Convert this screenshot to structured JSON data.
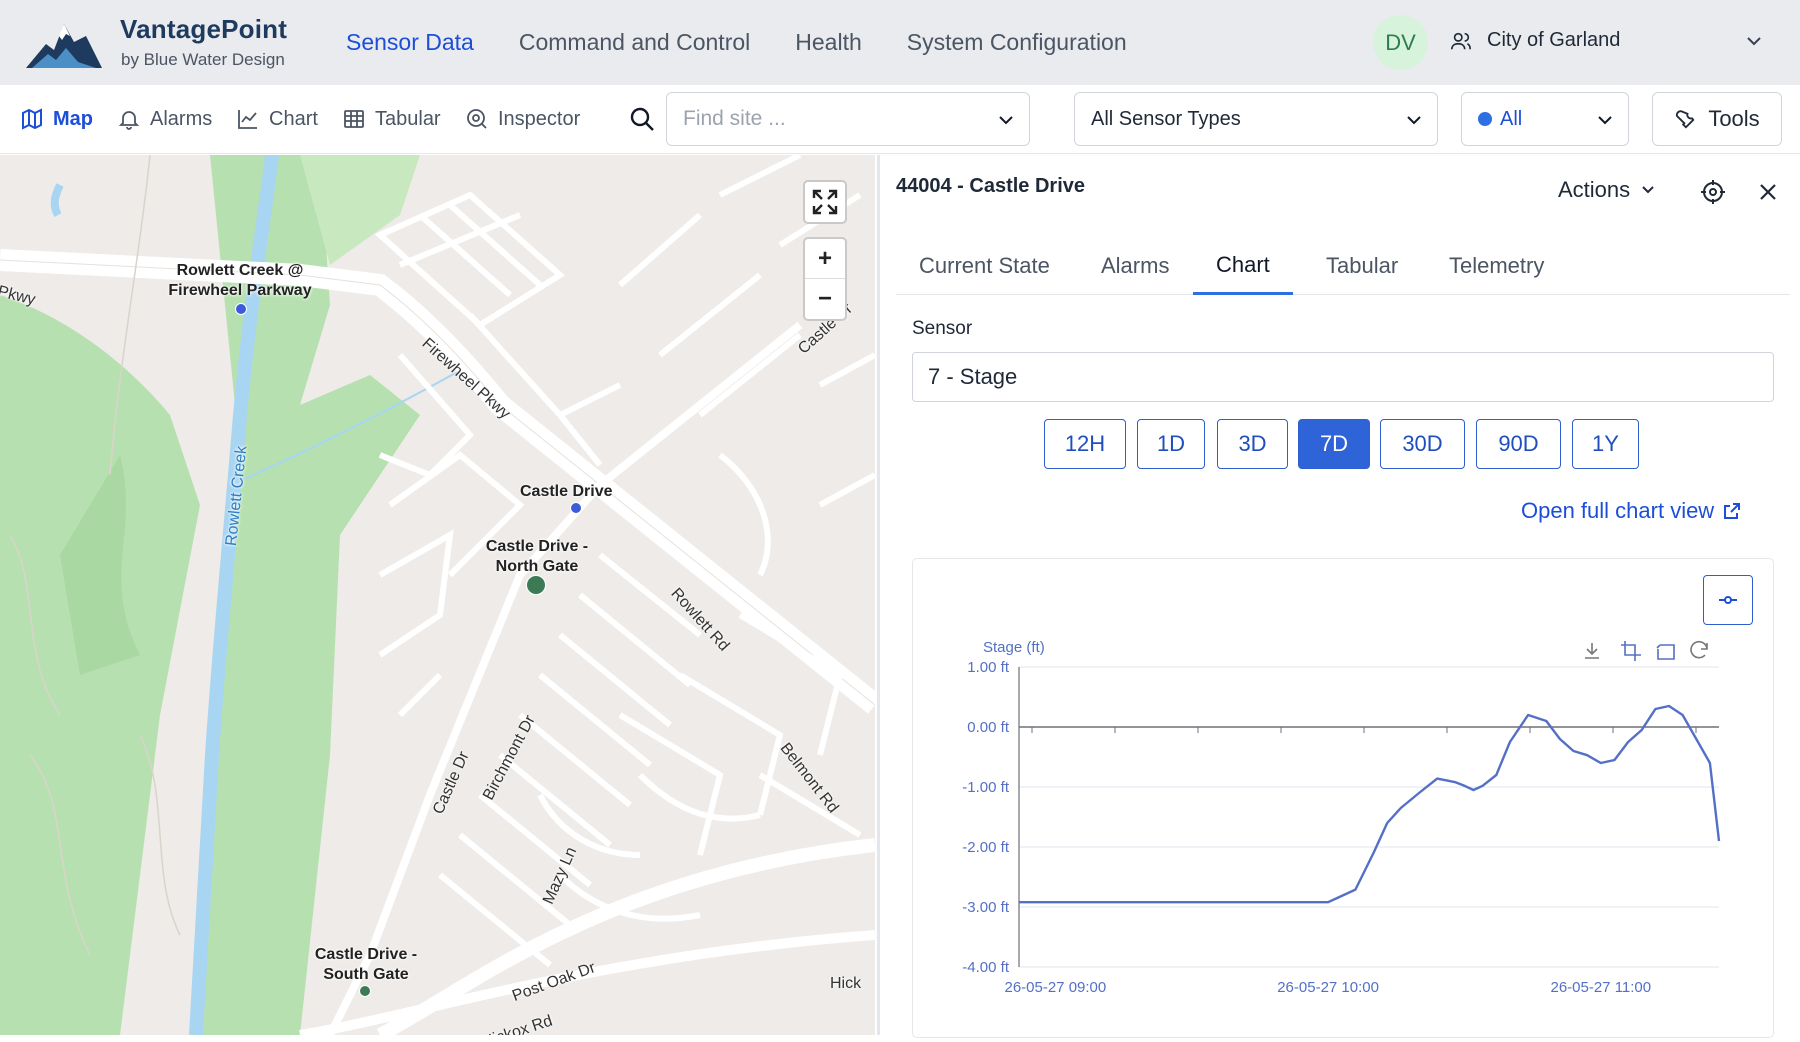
{
  "brand": {
    "name": "VantagePoint",
    "sub": "by Blue Water Design"
  },
  "nav": [
    {
      "label": "Sensor Data",
      "active": true
    },
    {
      "label": "Command and Control",
      "active": false
    },
    {
      "label": "Health",
      "active": false
    },
    {
      "label": "System Configuration",
      "active": false
    }
  ],
  "user": {
    "initials": "DV",
    "org": "City of Garland"
  },
  "toolbar": {
    "views": [
      "Map",
      "Alarms",
      "Chart",
      "Tabular",
      "Inspector"
    ],
    "active_view": "Map",
    "find_placeholder": "Find site ...",
    "sensor_types": "All Sensor Types",
    "status_filter": "All",
    "tools_label": "Tools"
  },
  "map": {
    "sites": [
      {
        "name": "Rowlett Creek @ Firewheel Parkway"
      },
      {
        "name": "Castle Drive"
      },
      {
        "name": "Castle Drive - North Gate"
      },
      {
        "name": "Castle Drive - South Gate"
      }
    ],
    "streets": [
      "Pkwy",
      "Firewheel Pkwy",
      "Rowlett Creek",
      "Castle Dr",
      "Rowlett Rd",
      "Birchmont Dr",
      "Castle Dr",
      "Belmont Rd",
      "Mazy Ln",
      "Post Oak Dr",
      "Hickox Rd",
      "Hick"
    ],
    "zoom_in": "+",
    "zoom_out": "−"
  },
  "panel": {
    "title": "44004 - Castle Drive",
    "actions_label": "Actions",
    "tabs": [
      "Current State",
      "Alarms",
      "Chart",
      "Tabular",
      "Telemetry"
    ],
    "active_tab": "Chart",
    "sensor_label": "Sensor",
    "sensor_value": "7 - Stage",
    "ranges": [
      "12H",
      "1D",
      "3D",
      "7D",
      "30D",
      "90D",
      "1Y"
    ],
    "active_range": "7D",
    "full_chart_link": "Open full chart view"
  },
  "colors": {
    "accent": "#2f64d8",
    "series": "#5470c6",
    "map_park": "#b7e0b0",
    "map_water": "#a8d5f2"
  },
  "chart_data": {
    "type": "line",
    "ylabel": "Stage (ft)",
    "ylim": [
      -4,
      1
    ],
    "yticks": [
      1,
      0,
      -1,
      -2,
      -3,
      -4
    ],
    "ytick_labels": [
      "1.00 ft",
      "0.00 ft",
      "-1.00 ft",
      "-2.00 ft",
      "-3.00 ft",
      "-4.00 ft"
    ],
    "xticks": [
      "26-05-27 09:00",
      "26-05-27 10:00",
      "26-05-27 11:00"
    ],
    "x_start": "26-05-27 08:52",
    "x_end": "26-05-27 11:26",
    "grid": true,
    "series": [
      {
        "x": [
          "08:52",
          "09:10",
          "09:30",
          "09:50",
          "10:00",
          "10:02",
          "10:06",
          "10:10",
          "10:13",
          "10:16",
          "10:20",
          "10:24",
          "10:28",
          "10:30",
          "10:32",
          "10:34",
          "10:37",
          "10:40",
          "10:44",
          "10:48",
          "10:51",
          "10:54",
          "10:57",
          "11:00",
          "11:03",
          "11:06",
          "11:09",
          "11:12",
          "11:15",
          "11:18",
          "11:21",
          "11:24",
          "11:26"
        ],
        "y": [
          -2.92,
          -2.92,
          -2.92,
          -2.92,
          -2.92,
          -2.85,
          -2.71,
          -2.1,
          -1.6,
          -1.35,
          -1.1,
          -0.86,
          -0.92,
          -0.98,
          -1.05,
          -0.98,
          -0.8,
          -0.25,
          0.2,
          0.1,
          -0.2,
          -0.4,
          -0.47,
          -0.6,
          -0.55,
          -0.25,
          -0.05,
          0.3,
          0.35,
          0.2,
          -0.2,
          -0.6,
          -1.9
        ]
      }
    ]
  }
}
